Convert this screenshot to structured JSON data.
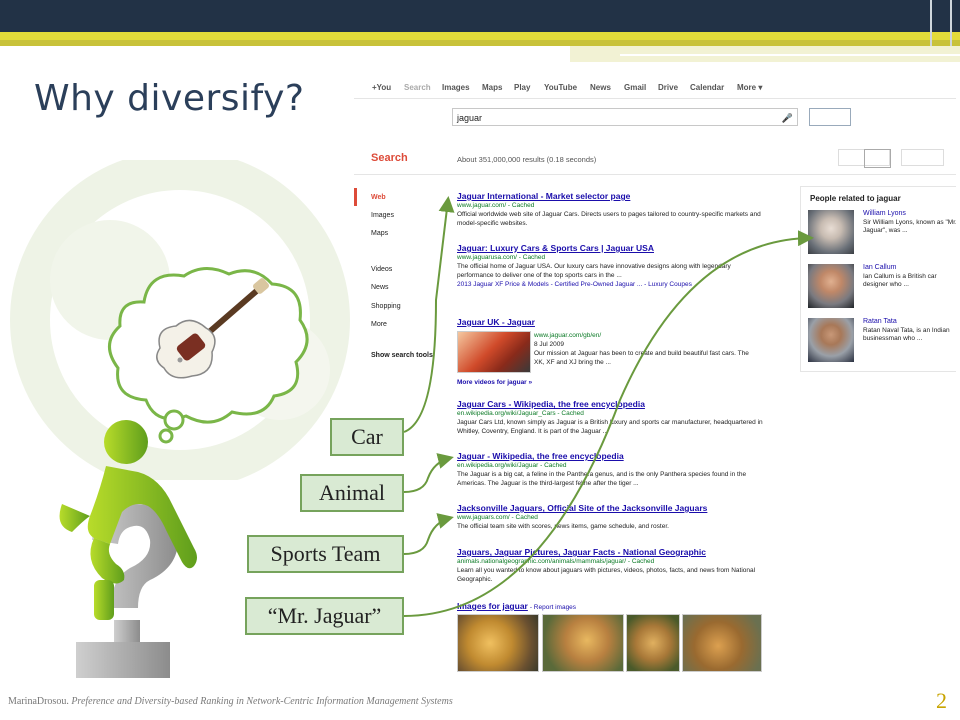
{
  "slide": {
    "title": "Why diversify?",
    "page_number": "2",
    "footer_author": "MarinaDrosou.",
    "footer_paper": "Preference and Diversity-based Ranking in Network-Centric Information Management Systems"
  },
  "labels": [
    "Car",
    "Animal",
    "Sports Team",
    "“Mr. Jaguar”"
  ],
  "colors": {
    "header": "#223246",
    "accent": "#e3dc3a",
    "label_fill": "#d9ead3",
    "label_border": "#76a35c",
    "arrow": "#6a9a3e"
  },
  "google": {
    "nav": [
      "+You",
      "Search",
      "Images",
      "Maps",
      "Play",
      "YouTube",
      "News",
      "Gmail",
      "Drive",
      "Calendar",
      "More ▾"
    ],
    "query": "jaguar",
    "search_label": "Search",
    "result_count": "About 351,000,000 results (0.18 seconds)",
    "left_nav": [
      "Web",
      "Images",
      "Maps",
      "Videos",
      "News",
      "Shopping",
      "More",
      "Show search tools"
    ],
    "results": [
      {
        "title": "Jaguar International - Market selector page",
        "url": "www.jaguar.com/ - Cached",
        "snippet": "Official worldwide web site of Jaguar Cars. Directs users to pages tailored to country-specific markets and model-specific websites."
      },
      {
        "title": "Jaguar: Luxury Cars & Sports Cars | Jaguar USA",
        "url": "www.jaguarusa.com/ - Cached",
        "snippet": "The official home of Jaguar USA. Our luxury cars have innovative designs along with legendary performance to deliver one of the top sports cars in the ...",
        "links": "2013 Jaguar XF Price & Models  -  Certified Pre-Owned Jaguar ...  -  Luxury Coupes"
      },
      {
        "title": "Jaguar UK - Jaguar",
        "url": "www.jaguar.com/gb/en/",
        "date": "8 Jul 2009",
        "snippet": "Our mission at Jaguar has been to create and build beautiful fast cars. The XK, XF and XJ bring the ...",
        "more": "More videos for jaguar »"
      },
      {
        "title": "Jaguar Cars - Wikipedia, the free encyclopedia",
        "url": "en.wikipedia.org/wiki/Jaguar_Cars - Cached",
        "snippet": "Jaguar Cars Ltd, known simply as Jaguar is a British luxury and sports car manufacturer, headquartered in Whitley, Coventry, England. It is part of the Jaguar ..."
      },
      {
        "title": "Jaguar - Wikipedia, the free encyclopedia",
        "url": "en.wikipedia.org/wiki/Jaguar - Cached",
        "snippet": "The Jaguar is a big cat, a feline in the Panthera genus, and is the only Panthera species found in the Americas. The Jaguar is the third-largest feline after the tiger ..."
      },
      {
        "title": "Jacksonville Jaguars, Official Site of the Jacksonville Jaguars",
        "url": "www.jaguars.com/ - Cached",
        "snippet": "The official team site with scores, news items, game schedule, and roster."
      },
      {
        "title": "Jaguars, Jaguar Pictures, Jaguar Facts - National Geographic",
        "url": "animals.nationalgeographic.com/animals/mammals/jaguar/ - Cached",
        "snippet": "Learn all you wanted to know about jaguars with pictures, videos, photos, facts, and news from National Geographic."
      }
    ],
    "images_for": "Images for jaguar",
    "report_images": "- Report images",
    "people_header": "People related to jaguar",
    "people": [
      {
        "name": "William Lyons",
        "desc": "Sir William Lyons, known as \"Mr. Jaguar\", was ..."
      },
      {
        "name": "Ian Callum",
        "desc": "Ian Callum is a British car designer who ..."
      },
      {
        "name": "Ratan Tata",
        "desc": "Ratan Naval Tata, is an Indian businessman who ..."
      }
    ]
  }
}
